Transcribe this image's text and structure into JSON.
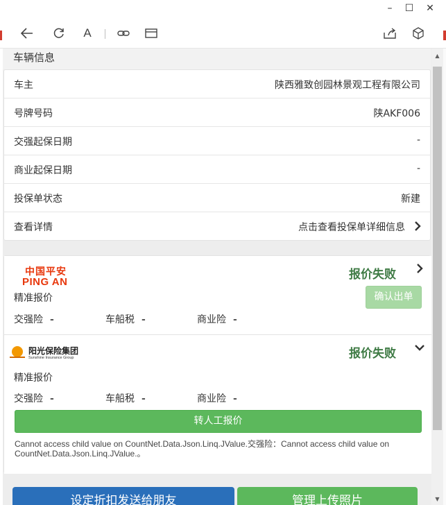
{
  "window": {
    "minimize": "–",
    "maximize": "☐",
    "close": "✕"
  },
  "colors": {
    "accent_green": "#5cb85c",
    "status_green": "#3f7b45",
    "primary_blue": "#2a6fba",
    "pingan_red": "#e8380d",
    "sunshine_orange": "#f39800"
  },
  "toolbar": {
    "icons": [
      "back-arrow-icon",
      "refresh-icon",
      "font-size-icon",
      "link-icon",
      "window-icon",
      "share-icon",
      "box-icon"
    ],
    "font_label": "A"
  },
  "vehicle": {
    "title": "车辆信息",
    "rows": [
      {
        "label": "车主",
        "value": "陕西雅致创园林景观工程有限公司"
      },
      {
        "label": "号牌号码",
        "value": "陕AKF006"
      },
      {
        "label": "交强起保日期",
        "value": "-"
      },
      {
        "label": "商业起保日期",
        "value": "-"
      },
      {
        "label": "投保单状态",
        "value": "新建"
      },
      {
        "label": "查看详情",
        "value": "点击查看投保单详细信息"
      }
    ]
  },
  "quotes": [
    {
      "logo_cn": "中国平安",
      "logo_en": "PING AN",
      "status": "报价失败",
      "type": "精准报价",
      "fields": [
        {
          "label": "交强险",
          "value": "-"
        },
        {
          "label": "车船税",
          "value": "-"
        },
        {
          "label": "商业险",
          "value": "-"
        }
      ],
      "confirm_label": "确认出单"
    },
    {
      "logo_cn": "阳光保险集团",
      "logo_en": "Sunshine Insurance Group",
      "status": "报价失败",
      "type": "精准报价",
      "fields": [
        {
          "label": "交强险",
          "value": "-"
        },
        {
          "label": "车船税",
          "value": "-"
        },
        {
          "label": "商业险",
          "value": "-"
        }
      ],
      "manual_label": "转人工报价",
      "error": "Cannot access child value on CountNet.Data.Json.Linq.JValue.交强险：Cannot access child value on CountNet.Data.Json.Linq.JValue.。"
    }
  ],
  "bottom": {
    "left_label": "设定折扣发送给朋友",
    "right_label": "管理上传照片"
  }
}
